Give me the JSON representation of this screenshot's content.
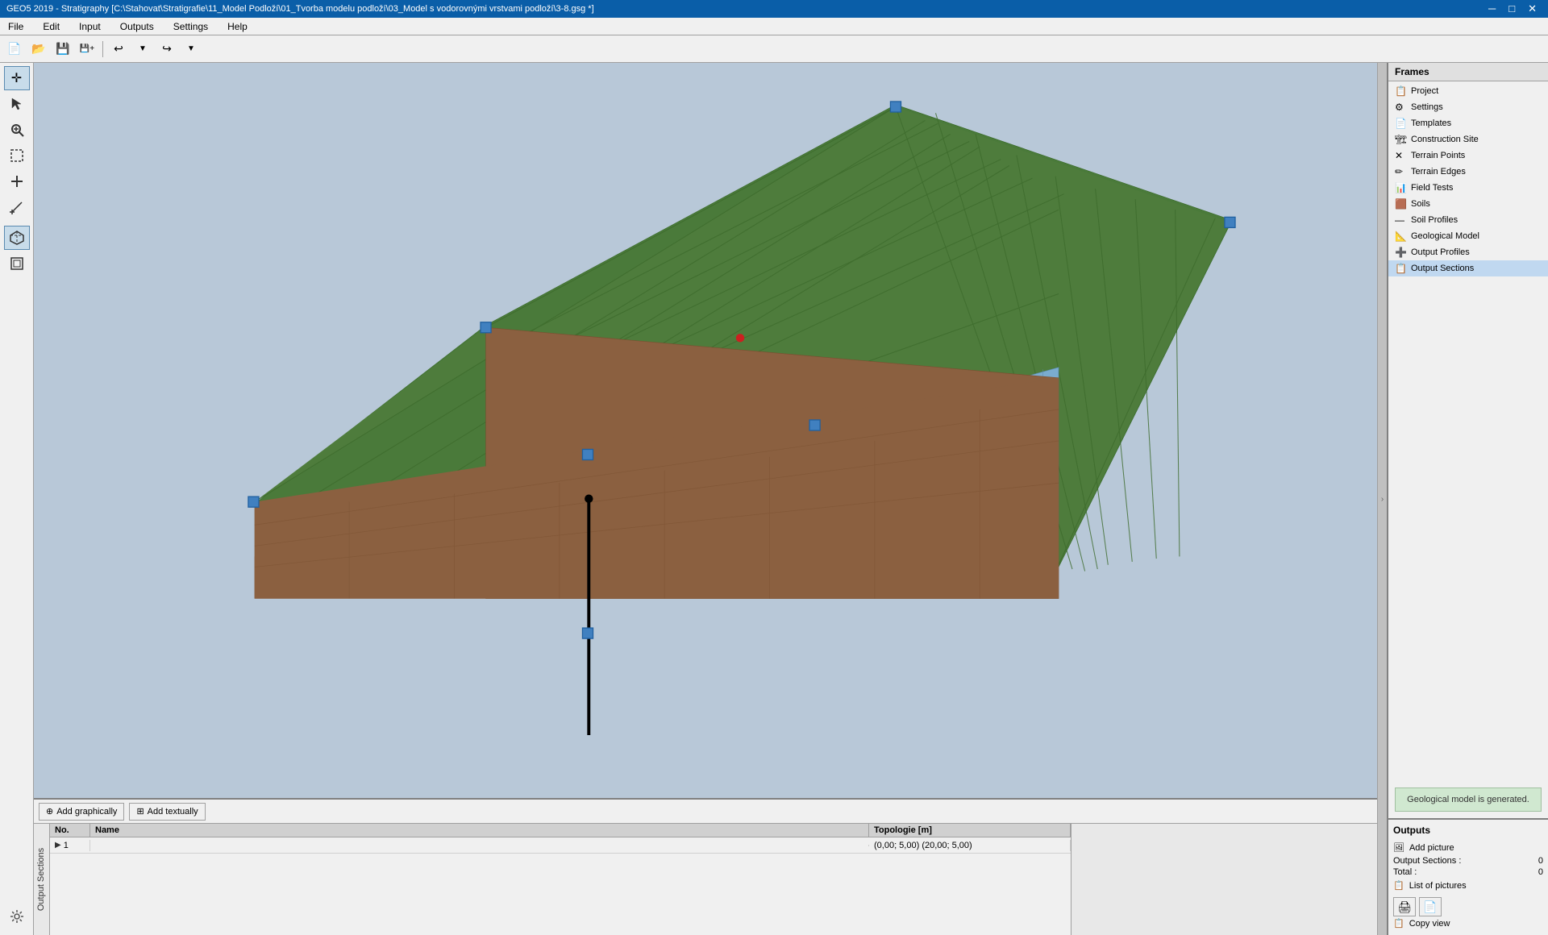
{
  "titlebar": {
    "title": "GEO5 2019 - Stratigraphy [C:\\Stahovat\\Stratigrafie\\11_Model Podloží\\01_Tvorba modelu podloží\\03_Model s vodorovnými vrstvami podloží\\3-8.gsg *]",
    "minimize": "─",
    "maximize": "□",
    "close": "✕"
  },
  "menubar": {
    "items": [
      "File",
      "Edit",
      "Input",
      "Outputs",
      "Settings",
      "Help"
    ]
  },
  "toolbar": {
    "new_label": "📄",
    "open_label": "📂",
    "save_label": "💾",
    "undo_label": "↩",
    "redo_label": "↪"
  },
  "left_toolbar": {
    "tools": [
      {
        "name": "move-tool",
        "icon": "✛",
        "active": true
      },
      {
        "name": "select-tool",
        "icon": "↖"
      },
      {
        "name": "zoom-tool",
        "icon": "🔍"
      },
      {
        "name": "region-select-tool",
        "icon": "⬜"
      },
      {
        "name": "node-tool",
        "icon": "⊕"
      },
      {
        "name": "measure-tool",
        "icon": "📐"
      },
      {
        "name": "view-3d-tool",
        "icon": "⬡",
        "active": false
      },
      {
        "name": "view-box-tool",
        "icon": "⬢"
      }
    ]
  },
  "frames": {
    "header": "Frames",
    "items": [
      {
        "name": "Project",
        "icon": "📋",
        "id": "project"
      },
      {
        "name": "Settings",
        "icon": "⚙",
        "id": "settings"
      },
      {
        "name": "Templates",
        "icon": "📄",
        "id": "templates"
      },
      {
        "name": "Construction Site",
        "icon": "🏗",
        "id": "construction-site"
      },
      {
        "name": "Terrain Points",
        "icon": "✕",
        "id": "terrain-points"
      },
      {
        "name": "Terrain Edges",
        "icon": "✏",
        "id": "terrain-edges"
      },
      {
        "name": "Field Tests",
        "icon": "📊",
        "id": "field-tests"
      },
      {
        "name": "Soils",
        "icon": "🟫",
        "id": "soils"
      },
      {
        "name": "Soil Profiles",
        "icon": "—",
        "id": "soil-profiles"
      },
      {
        "name": "Geological Model",
        "icon": "📐",
        "id": "geological-model"
      },
      {
        "name": "Output Profiles",
        "icon": "➕",
        "id": "output-profiles"
      },
      {
        "name": "Output Sections",
        "icon": "📋",
        "id": "output-sections",
        "active": true
      }
    ]
  },
  "geological_info": "Geological model\nis generated.",
  "outputs": {
    "header": "Outputs",
    "add_picture": "Add picture",
    "output_sections_label": "Output Sections :",
    "output_sections_value": "0",
    "total_label": "Total :",
    "total_value": "0",
    "list_of_pictures": "List of pictures",
    "copy_view": "Copy view"
  },
  "bottom": {
    "add_graphically": "Add graphically",
    "add_textually": "Add textually",
    "output_sections_side": "Output Sections",
    "table": {
      "headers": [
        "No.",
        "Name",
        "Topologie [m]"
      ],
      "rows": [
        {
          "no": "1",
          "name": "",
          "topology": "(0,00; 5,00) (20,00; 5,00)"
        }
      ]
    }
  }
}
